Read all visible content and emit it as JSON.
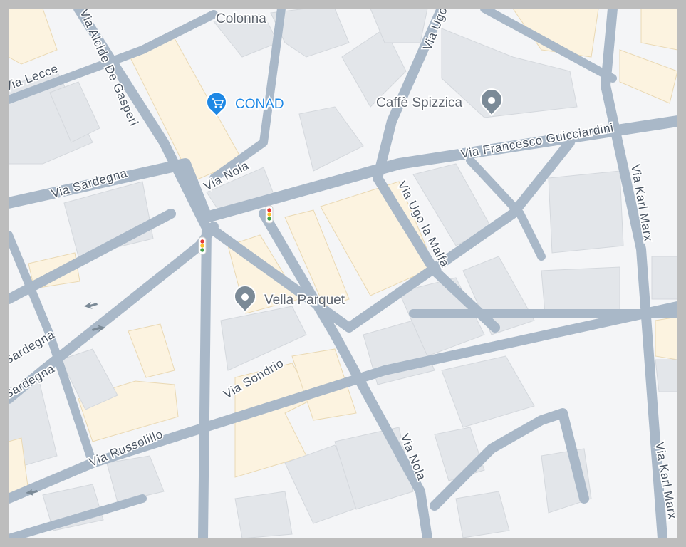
{
  "map": {
    "colors": {
      "background": "#f4f5f7",
      "road": "#a9b8c8",
      "building": "#e3e6ea",
      "building_highlight": "#fcf3e0",
      "shop_accent": "#1e88e5",
      "pin": "#7b8a97",
      "frame": "#bdbdbd"
    },
    "places": {
      "colonna": "Colonna",
      "conad": "CONAD",
      "caffe": "Caffè Spizzica",
      "vella": "Vella Parquet"
    },
    "streets": {
      "alcide": "Via Alcide De Gasperi",
      "lecce": "Via Lecce",
      "sardegna_1": "Via Sardegna",
      "nola_1": "Via Nola",
      "ugo_1": "Via Ugo",
      "guicciardini": "Via Francesco Guicciardini",
      "ugo_la_malfa": "Via Ugo la Malfa",
      "karl_marx_1": "Via Karl Marx",
      "sardegna_2": "Sardegna",
      "sardegna_3": "Sardegna",
      "sondrio": "Via Sondrio",
      "russolillo": "Via Russolillo",
      "nola_2": "Via Nola",
      "karl_marx_2": "Via Karl Marx"
    },
    "icons": {
      "shop": "shopping-cart-icon",
      "place": "place-pin-icon",
      "traffic_light": "traffic-light-icon",
      "one_way": "one-way-arrow-icon"
    }
  }
}
